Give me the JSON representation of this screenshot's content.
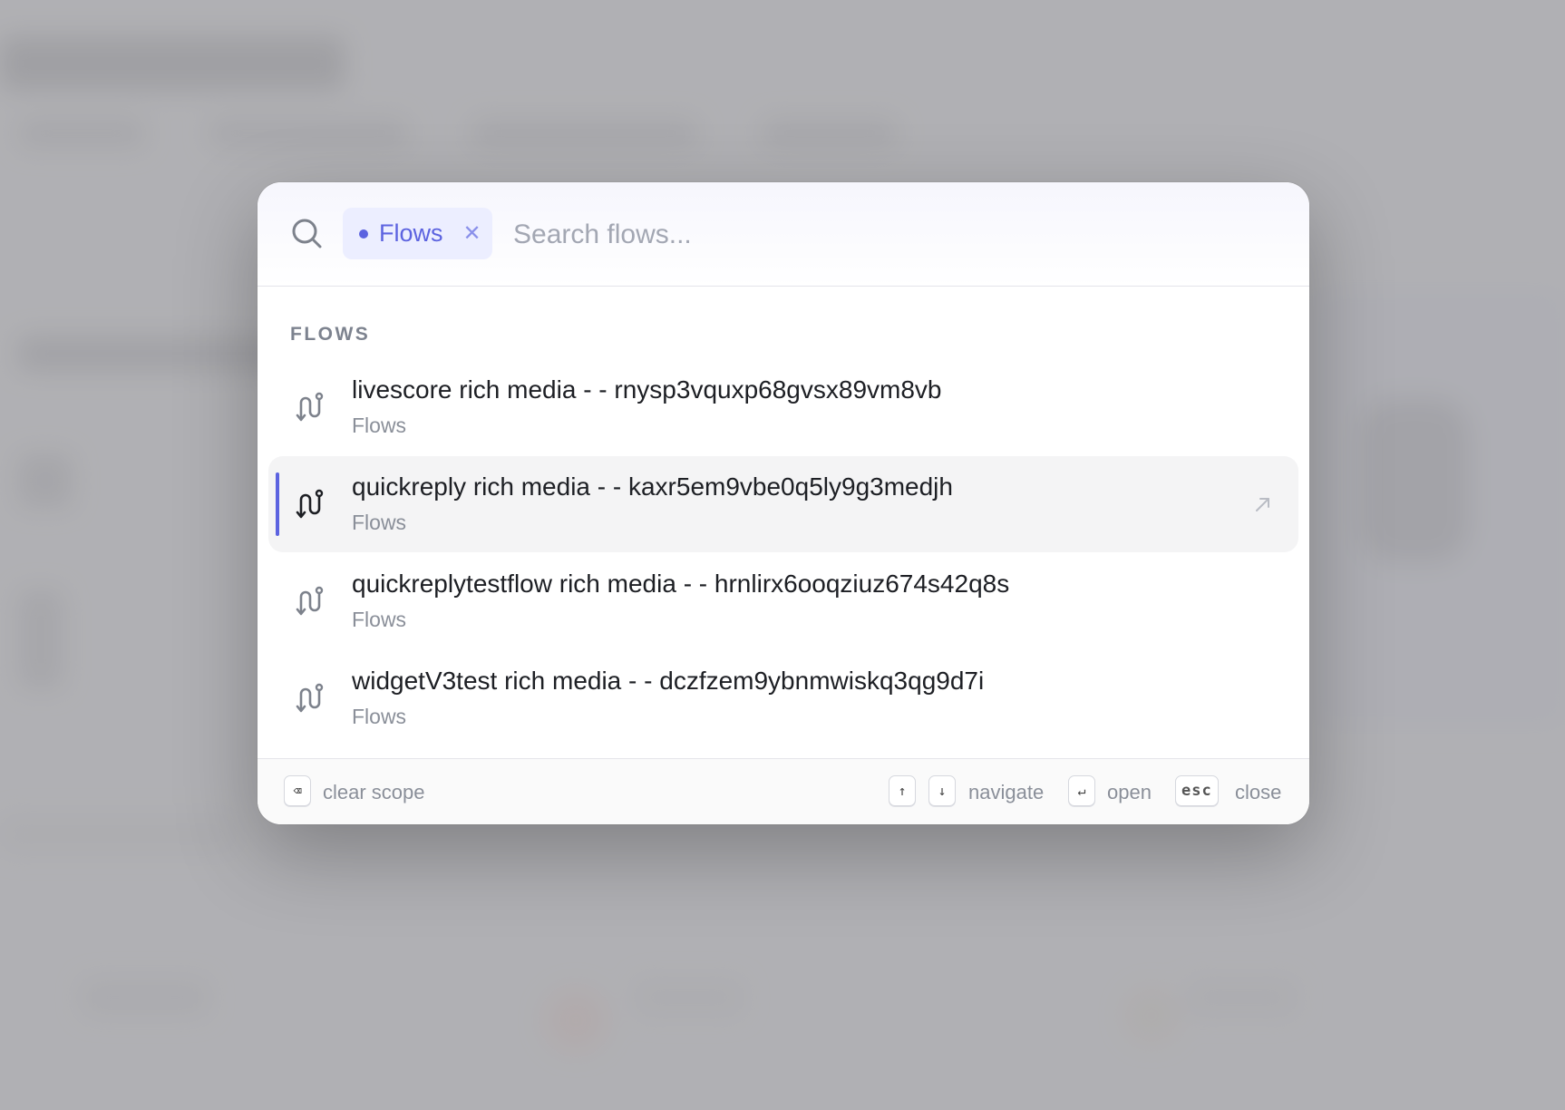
{
  "search": {
    "scope_chip_label": "Flows",
    "placeholder": "Search flows..."
  },
  "section": {
    "label": "FLOWS"
  },
  "results": [
    {
      "title": "livescore rich media - - rnysp3vquxp68gvsx89vm8vb",
      "subtitle": "Flows",
      "selected": false
    },
    {
      "title": "quickreply rich media - - kaxr5em9vbe0q5ly9g3medjh",
      "subtitle": "Flows",
      "selected": true
    },
    {
      "title": "quickreplytestflow rich media - - hrnlirx6ooqziuz674s42q8s",
      "subtitle": "Flows",
      "selected": false
    },
    {
      "title": "widgetV3test rich media - - dczfzem9ybnmwiskq3qg9d7i",
      "subtitle": "Flows",
      "selected": false
    }
  ],
  "footer": {
    "clear_scope_key": "⌫",
    "clear_scope_label": "clear scope",
    "up_key": "↑",
    "down_key": "↓",
    "navigate_label": "navigate",
    "open_key": "↵",
    "open_label": "open",
    "esc_key": "esc",
    "close_label": "close"
  },
  "colors": {
    "accent": "#5c63e0",
    "chip_background": "#eceeff",
    "selected_row": "#f4f4f5"
  },
  "icons": {
    "search": "search-icon",
    "flow": "flow-icon",
    "open": "arrow-up-right-icon",
    "close": "close-icon"
  }
}
